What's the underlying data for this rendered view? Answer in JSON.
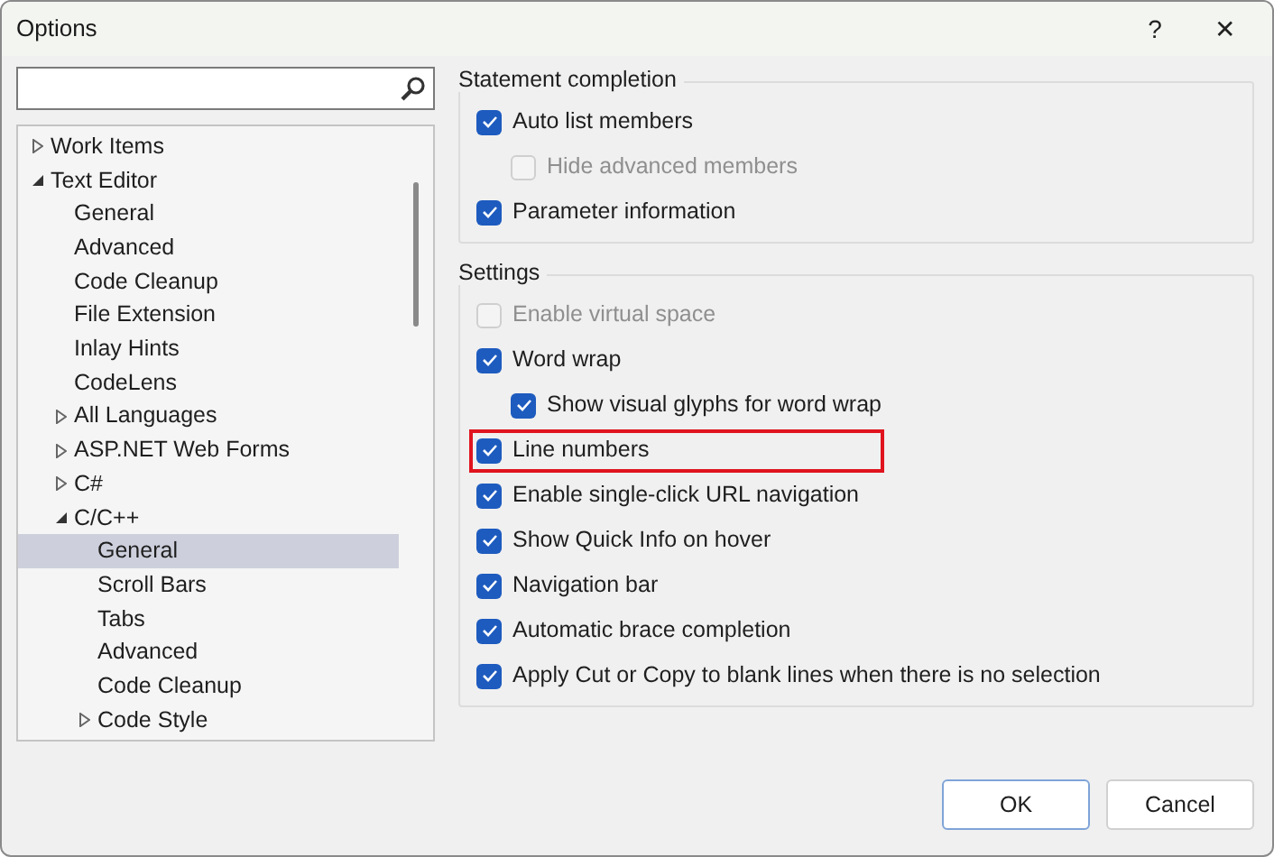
{
  "window": {
    "title": "Options",
    "help": "?",
    "close": "✕"
  },
  "tree": [
    {
      "label": "Work Items",
      "expanded": false,
      "selected": false
    },
    {
      "label": "Text Editor",
      "expanded": true,
      "selected": false,
      "children": [
        {
          "label": "General",
          "selected": false
        },
        {
          "label": "Advanced",
          "selected": false
        },
        {
          "label": "Code Cleanup",
          "selected": false
        },
        {
          "label": "File Extension",
          "selected": false
        },
        {
          "label": "Inlay Hints",
          "selected": false
        },
        {
          "label": "CodeLens",
          "selected": false
        },
        {
          "label": "All Languages",
          "expanded": false,
          "selected": false
        },
        {
          "label": "ASP.NET Web Forms",
          "expanded": false,
          "selected": false
        },
        {
          "label": "C#",
          "expanded": false,
          "selected": false
        },
        {
          "label": "C/C++",
          "expanded": true,
          "selected": false,
          "children": [
            {
              "label": "General",
              "selected": true
            },
            {
              "label": "Scroll Bars",
              "selected": false
            },
            {
              "label": "Tabs",
              "selected": false
            },
            {
              "label": "Advanced",
              "selected": false
            },
            {
              "label": "Code Cleanup",
              "selected": false
            },
            {
              "label": "Code Style",
              "expanded": false,
              "selected": false
            }
          ]
        }
      ]
    }
  ],
  "groups": [
    {
      "title": "Statement completion",
      "options": [
        {
          "label": "Auto list members",
          "checked": true,
          "disabled": false,
          "indented": false,
          "highlighted": false
        },
        {
          "label": "Hide advanced members",
          "checked": false,
          "disabled": true,
          "indented": true,
          "highlighted": false
        },
        {
          "label": "Parameter information",
          "checked": true,
          "disabled": false,
          "indented": false,
          "highlighted": false
        }
      ]
    },
    {
      "title": "Settings",
      "options": [
        {
          "label": "Enable virtual space",
          "checked": false,
          "disabled": true,
          "indented": false,
          "highlighted": false
        },
        {
          "label": "Word wrap",
          "checked": true,
          "disabled": false,
          "indented": false,
          "highlighted": false
        },
        {
          "label": "Show visual glyphs for word wrap",
          "checked": true,
          "disabled": false,
          "indented": true,
          "highlighted": false
        },
        {
          "label": "Line numbers",
          "checked": true,
          "disabled": false,
          "indented": false,
          "highlighted": true
        },
        {
          "label": "Enable single-click URL navigation",
          "checked": true,
          "disabled": false,
          "indented": false,
          "highlighted": false
        },
        {
          "label": "Show Quick Info on hover",
          "checked": true,
          "disabled": false,
          "indented": false,
          "highlighted": false
        },
        {
          "label": "Navigation bar",
          "checked": true,
          "disabled": false,
          "indented": false,
          "highlighted": false
        },
        {
          "label": "Automatic brace completion",
          "checked": true,
          "disabled": false,
          "indented": false,
          "highlighted": false
        },
        {
          "label": "Apply Cut or Copy to blank lines when there is no selection",
          "checked": true,
          "disabled": false,
          "indented": false,
          "highlighted": false
        }
      ]
    }
  ],
  "buttons": [
    {
      "label": "OK",
      "default": true
    },
    {
      "label": "Cancel",
      "default": false
    }
  ]
}
